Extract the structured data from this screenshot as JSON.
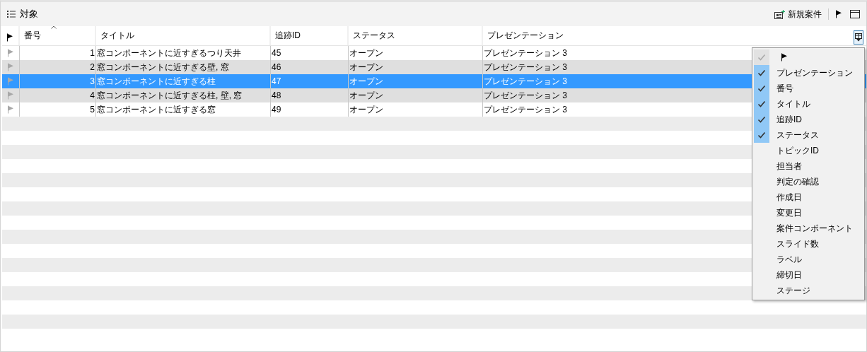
{
  "panel": {
    "title": "対象",
    "new_case_label": "新規案件"
  },
  "table": {
    "columns": [
      {
        "label": "番号",
        "sorted": true
      },
      {
        "label": "タイトル",
        "sorted": false
      },
      {
        "label": "追跡ID",
        "sorted": false
      },
      {
        "label": "ステータス",
        "sorted": false
      },
      {
        "label": "プレゼンテーション",
        "sorted": false
      }
    ],
    "rows": [
      {
        "cells": [
          "1",
          "窓コンポーネントに近すぎるつり天井",
          "45",
          "オープン",
          "プレゼンテーション 3"
        ],
        "selected": false
      },
      {
        "cells": [
          "2",
          "窓コンポーネントに近すぎる壁, 窓",
          "46",
          "オープン",
          "プレゼンテーション 3"
        ],
        "selected": false
      },
      {
        "cells": [
          "3",
          "窓コンポーネントに近すぎる柱",
          "47",
          "オープン",
          "プレゼンテーション 3"
        ],
        "selected": true
      },
      {
        "cells": [
          "4",
          "窓コンポーネントに近すぎる柱, 壁, 窓",
          "48",
          "オープン",
          "プレゼンテーション 3"
        ],
        "selected": false
      },
      {
        "cells": [
          "5",
          "窓コンポーネントに近すぎる窓",
          "49",
          "オープン",
          "プレゼンテーション 3"
        ],
        "selected": false
      }
    ]
  },
  "column_menu": {
    "items": [
      {
        "kind": "flag",
        "checked": true,
        "disabled": true
      },
      {
        "kind": "text",
        "label": "プレゼンテーション",
        "checked": true
      },
      {
        "kind": "text",
        "label": "番号",
        "checked": true
      },
      {
        "kind": "text",
        "label": "タイトル",
        "checked": true
      },
      {
        "kind": "text",
        "label": "追跡ID",
        "checked": true
      },
      {
        "kind": "text",
        "label": "ステータス",
        "checked": true
      },
      {
        "kind": "text",
        "label": "トピックID",
        "checked": false
      },
      {
        "kind": "text",
        "label": "担当者",
        "checked": false
      },
      {
        "kind": "text",
        "label": "判定の確認",
        "checked": false
      },
      {
        "kind": "text",
        "label": "作成日",
        "checked": false
      },
      {
        "kind": "text",
        "label": "変更日",
        "checked": false
      },
      {
        "kind": "text",
        "label": "案件コンポーネント",
        "checked": false
      },
      {
        "kind": "text",
        "label": "スライド数",
        "checked": false
      },
      {
        "kind": "text",
        "label": "ラベル",
        "checked": false
      },
      {
        "kind": "text",
        "label": "締切日",
        "checked": false
      },
      {
        "kind": "text",
        "label": "ステージ",
        "checked": false
      }
    ]
  }
}
